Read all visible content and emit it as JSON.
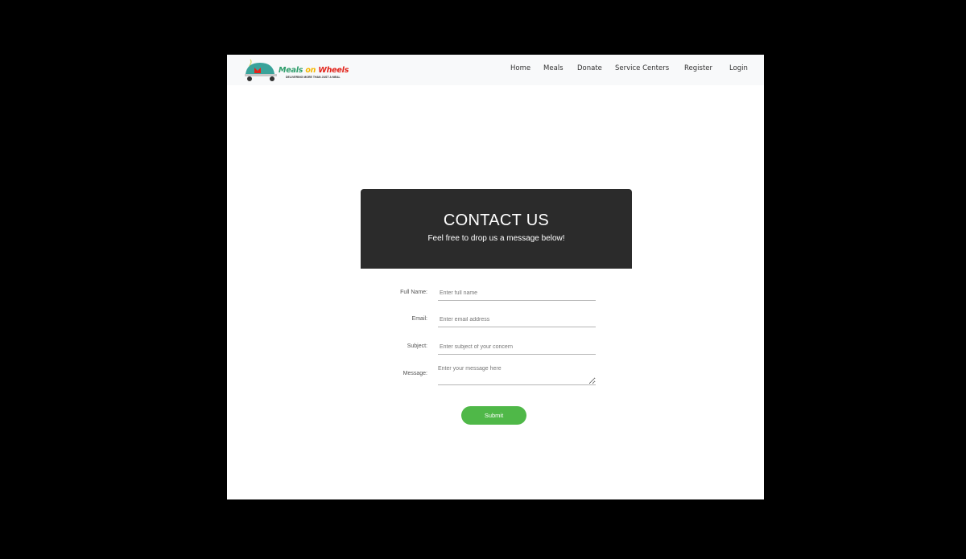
{
  "brand": {
    "word_meals": "Meals",
    "word_on": "on",
    "word_wheels": "Wheels",
    "tagline": "DELIVERING MORE THAN JUST A MEAL",
    "logo_letter": "M",
    "colors": {
      "meals": "#2e9e6b",
      "on": "#f5b800",
      "wheels": "#e2231a",
      "cart": "#3aa39a"
    }
  },
  "nav": {
    "items": [
      {
        "label": "Home"
      },
      {
        "label": "Meals"
      },
      {
        "label": "Donate"
      },
      {
        "label": "Service Centers"
      },
      {
        "label": "Register"
      },
      {
        "label": "Login"
      }
    ]
  },
  "banner": {
    "title": "CONTACT US",
    "subtitle": "Feel free to drop us a message below!",
    "background": "#2b2b2b"
  },
  "form": {
    "full_name": {
      "label": "Full Name:",
      "placeholder": "Enter full name",
      "value": ""
    },
    "email": {
      "label": "Email:",
      "placeholder": "Enter email address",
      "value": ""
    },
    "subject": {
      "label": "Subject:",
      "placeholder": "Enter subject of your concern",
      "value": ""
    },
    "message": {
      "label": "Message:",
      "placeholder": "Enter your message here",
      "value": ""
    },
    "submit_label": "Submit",
    "submit_color": "#4fb848"
  }
}
